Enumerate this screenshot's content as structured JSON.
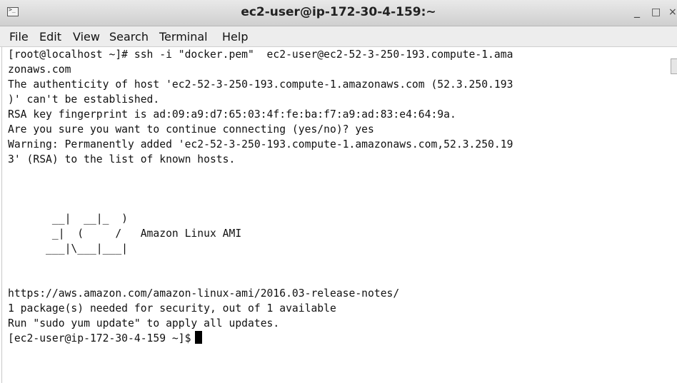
{
  "window": {
    "title": "ec2-user@ip-172-30-4-159:~",
    "icon": "terminal-icon",
    "controls": {
      "minimize": "_",
      "maximize": "□",
      "close": "×"
    }
  },
  "menubar": {
    "items": [
      "File",
      "Edit",
      "View",
      "Search",
      "Terminal",
      "Help"
    ]
  },
  "terminal": {
    "lines": [
      "[root@localhost ~]# ssh -i \"docker.pem\"  ec2-user@ec2-52-3-250-193.compute-1.ama",
      "zonaws.com",
      "The authenticity of host 'ec2-52-3-250-193.compute-1.amazonaws.com (52.3.250.193",
      ")' can't be established.",
      "RSA key fingerprint is ad:09:a9:d7:65:03:4f:fe:ba:f7:a9:ad:83:e4:64:9a.",
      "Are you sure you want to continue connecting (yes/no)? yes",
      "Warning: Permanently added 'ec2-52-3-250-193.compute-1.amazonaws.com,52.3.250.19",
      "3' (RSA) to the list of known hosts.",
      "",
      "       __|  __|_  )",
      "       _|  (     /   Amazon Linux AMI",
      "      ___|\\___|___|",
      "",
      "https://aws.amazon.com/amazon-linux-ami/2016.03-release-notes/",
      "1 package(s) needed for security, out of 1 available",
      "Run \"sudo yum update\" to apply all updates."
    ],
    "prompt": "[ec2-user@ip-172-30-4-159 ~]$"
  }
}
